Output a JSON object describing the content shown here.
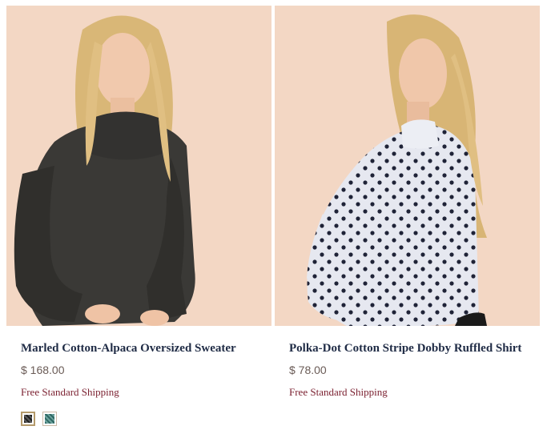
{
  "products": [
    {
      "name": "Marled Cotton-Alpaca Oversized Sweater",
      "price": "$ 168.00",
      "shipping": "Free Standard Shipping",
      "image_alt": "model wearing charcoal marled turtleneck sweater",
      "swatches": [
        {
          "color_name": "charcoal",
          "color": "#2e2e2e",
          "selected": true
        },
        {
          "color_name": "teal",
          "color": "#3f7c78",
          "selected": false
        }
      ]
    },
    {
      "name": "Polka-Dot Cotton Stripe Dobby Ruffled Shirt",
      "price": "$ 78.00",
      "shipping": "Free Standard Shipping",
      "image_alt": "model wearing white polka-dot ruffled shirt"
    }
  ],
  "colors": {
    "title": "#1f2b45",
    "price": "#6a5b56",
    "shipping": "#7a1f2f",
    "background": "#f2d6c3"
  }
}
